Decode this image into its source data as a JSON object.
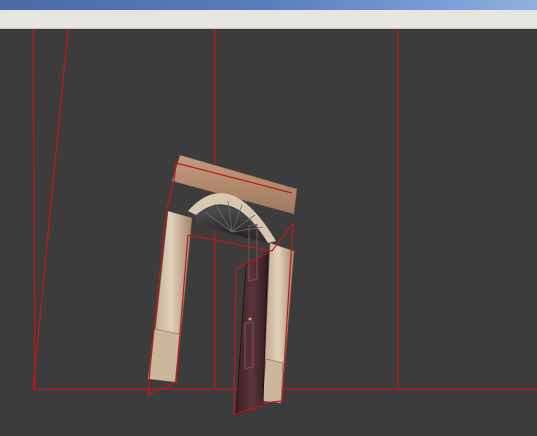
{
  "app": {
    "window_title": "",
    "toolbar_text": ""
  },
  "viewport": {
    "background_color": "#3c3c3c",
    "guide_color": "#c01818",
    "scene_object": "arched-doorway-model",
    "scene_parts": [
      "stone-arch-frame",
      "fanlight-window",
      "open-wooden-door-panel",
      "bounding-wireframe"
    ]
  }
}
